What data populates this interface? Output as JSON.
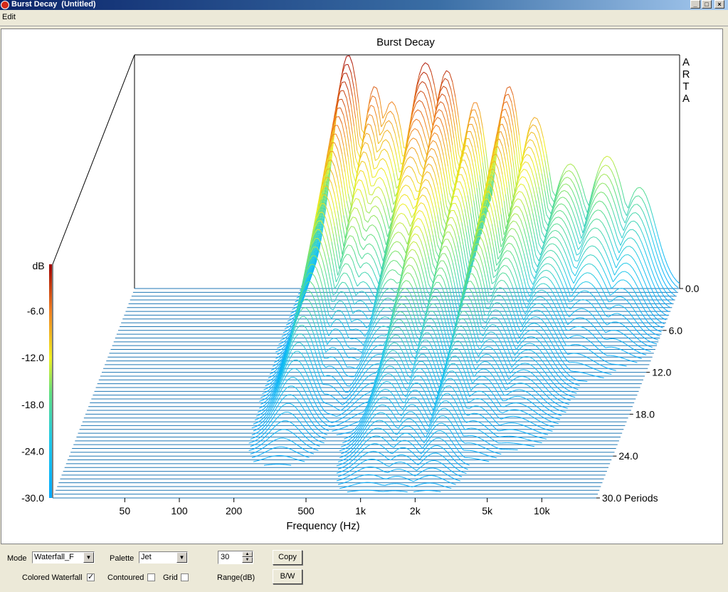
{
  "window": {
    "title": "Burst Decay  (Untitled)",
    "icon": "arta-app-icon",
    "buttons": [
      "minimize-icon",
      "maximize-icon",
      "close-icon"
    ]
  },
  "menu": {
    "items": [
      "Edit"
    ]
  },
  "chart_data": {
    "type": "waterfall",
    "title": "Burst Decay",
    "watermark": "ARTA",
    "xlabel": "Frequency (Hz)",
    "x_scale": "log",
    "x_ticks": [
      "50",
      "100",
      "200",
      "500",
      "1k",
      "2k",
      "5k",
      "10k"
    ],
    "x_tick_values": [
      50,
      100,
      200,
      500,
      1000,
      2000,
      5000,
      10000
    ],
    "xlim": [
      20,
      20000
    ],
    "z_label_suffix": "Periods",
    "z_ticks": [
      "0.0",
      "6.0",
      "12.0",
      "18.0",
      "24.0",
      "30.0 Periods"
    ],
    "z_tick_values": [
      0,
      6,
      12,
      18,
      24,
      30
    ],
    "zlim": [
      0,
      30
    ],
    "colorbar_label": "dB",
    "y_ticks": [
      "-6.0",
      "-12.0",
      "-18.0",
      "-24.0",
      "-30.0"
    ],
    "y_tick_values": [
      -6,
      -12,
      -18,
      -24,
      -30
    ],
    "ylim": [
      -30,
      0
    ],
    "slice_count": 56,
    "palette": "Jet",
    "colors": {
      "background": "#ffffff",
      "floor_lines": "#1f77b4",
      "axis": "#000000"
    },
    "peaks": [
      {
        "freq_hz": 300,
        "height_db": 30,
        "width_oct": 0.28,
        "decay_periods": 26
      },
      {
        "freq_hz": 420,
        "height_db": 26,
        "width_oct": 0.25,
        "decay_periods": 20
      },
      {
        "freq_hz": 520,
        "height_db": 24,
        "width_oct": 0.3,
        "decay_periods": 18
      },
      {
        "freq_hz": 800,
        "height_db": 29,
        "width_oct": 0.35,
        "decay_periods": 22
      },
      {
        "freq_hz": 1050,
        "height_db": 28,
        "width_oct": 0.3,
        "decay_periods": 30
      },
      {
        "freq_hz": 1500,
        "height_db": 24,
        "width_oct": 0.25,
        "decay_periods": 30
      },
      {
        "freq_hz": 2300,
        "height_db": 26,
        "width_oct": 0.25,
        "decay_periods": 30
      },
      {
        "freq_hz": 3200,
        "height_db": 22,
        "width_oct": 0.3,
        "decay_periods": 26
      },
      {
        "freq_hz": 5000,
        "height_db": 16,
        "width_oct": 0.35,
        "decay_periods": 24
      },
      {
        "freq_hz": 8000,
        "height_db": 17,
        "width_oct": 0.35,
        "decay_periods": 14
      },
      {
        "freq_hz": 12000,
        "height_db": 13,
        "width_oct": 0.3,
        "decay_periods": 12
      }
    ]
  },
  "controls": {
    "mode_label": "Mode",
    "mode_value": "Waterfall_F",
    "palette_label": "Palette",
    "palette_value": "Jet",
    "range_value": "30",
    "range_label": "Range(dB)",
    "copy_label": "Copy",
    "bw_label": "B/W",
    "colored_waterfall_label": "Colored Waterfall",
    "colored_waterfall_checked": true,
    "contoured_label": "Contoured",
    "contoured_checked": false,
    "grid_label": "Grid",
    "grid_checked": false
  }
}
